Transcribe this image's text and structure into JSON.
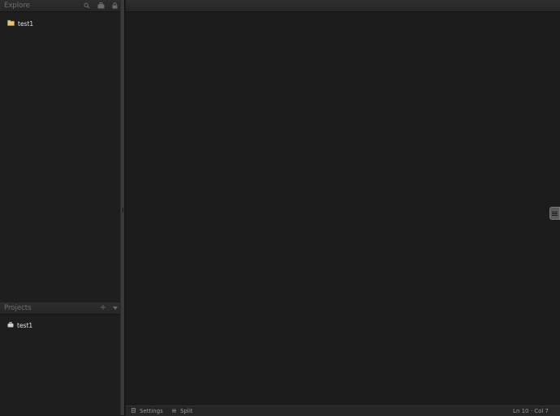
{
  "explore": {
    "title": "Explore",
    "items": [
      {
        "label": "test1",
        "icon": "folder-icon"
      }
    ]
  },
  "projects": {
    "title": "Projects",
    "items": [
      {
        "label": "test1",
        "icon": "project-icon"
      }
    ]
  },
  "statusbar": {
    "settings_label": "Settings",
    "split_label": "Split",
    "position": "Ln 10 · Col 7"
  },
  "colors": {
    "background": "#1b1b1b",
    "folder": "#e8c27a"
  }
}
